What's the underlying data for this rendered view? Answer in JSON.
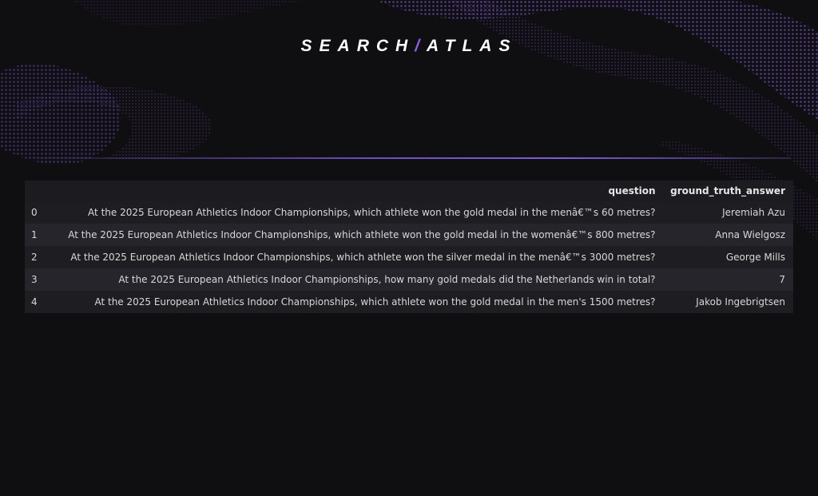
{
  "brand": {
    "logo_left": "SEARCH",
    "logo_slash": "/",
    "logo_right": "ATLAS",
    "accent": "#8b5cf6"
  },
  "table": {
    "columns": [
      "",
      "question",
      "ground_truth_answer"
    ],
    "rows": [
      {
        "index": "0",
        "question": "At the 2025 European Athletics Indoor Championships, which athlete won the gold medal in the menâ€™s 60 metres?",
        "answer": "Jeremiah Azu"
      },
      {
        "index": "1",
        "question": "At the 2025 European Athletics Indoor Championships, which athlete won the gold medal in the womenâ€™s 800 metres?",
        "answer": "Anna Wielgosz"
      },
      {
        "index": "2",
        "question": "At the 2025 European Athletics Indoor Championships, which athlete won the silver medal in the menâ€™s 3000 metres?",
        "answer": "George Mills"
      },
      {
        "index": "3",
        "question": "At the 2025 European Athletics Indoor Championships, how many gold medals did the Netherlands win in total?",
        "answer": "7"
      },
      {
        "index": "4",
        "question": "At the 2025 European Athletics Indoor Championships, which athlete won the gold medal in the men's 1500 metres?",
        "answer": "Jakob Ingebrigtsen"
      }
    ]
  }
}
